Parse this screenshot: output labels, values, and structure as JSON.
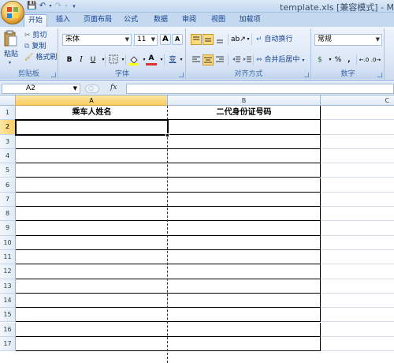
{
  "window": {
    "title": "template.xls  [兼容模式] - Mi"
  },
  "tabs": [
    "开始",
    "插入",
    "页面布局",
    "公式",
    "数据",
    "审阅",
    "视图",
    "加载项"
  ],
  "ribbon": {
    "clipboard": {
      "paste": "粘贴",
      "cut": "剪切",
      "copy": "复制",
      "format_painter": "格式刷",
      "label": "剪贴板"
    },
    "font": {
      "name": "宋体",
      "size": "11",
      "bold": "B",
      "italic": "I",
      "underline": "U",
      "font_color": "A",
      "phonetic": "变",
      "grow": "A",
      "shrink": "A",
      "label": "字体"
    },
    "alignment": {
      "wrap": "自动换行",
      "merge": "合并后居中",
      "label": "对齐方式"
    },
    "number": {
      "format": "常规",
      "currency": "$",
      "percent": "%",
      "comma": ",",
      "label": "数字"
    }
  },
  "formula_bar": {
    "name_box": "A2",
    "fx": "fx"
  },
  "sheet": {
    "columns": [
      "A",
      "B",
      "C"
    ],
    "rows": [
      "1",
      "2",
      "3",
      "4",
      "5",
      "6",
      "7",
      "8",
      "9",
      "10",
      "11",
      "12",
      "13",
      "14",
      "15",
      "16",
      "17"
    ],
    "headers": [
      "乘车人姓名",
      "二代身份证号码"
    ],
    "selected_cell": "A2"
  }
}
